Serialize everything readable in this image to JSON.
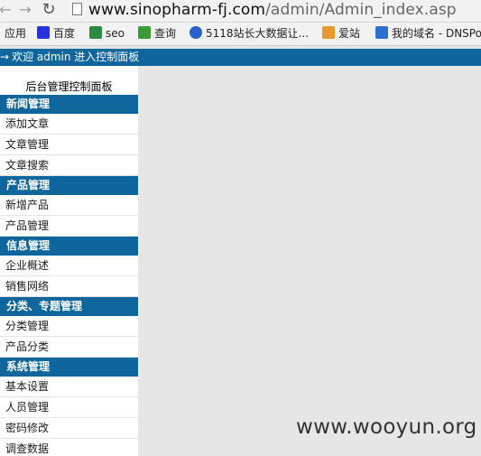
{
  "browser": {
    "url_host": "www.sinopharm-fj.com",
    "url_path": "/admin/Admin_index.asp",
    "bookmarks": [
      {
        "label": "应用",
        "icon": "apps-icon",
        "color": "#2a7de1"
      },
      {
        "label": "百度",
        "icon": "baidu-icon",
        "color": "#2932e1"
      },
      {
        "label": "seo",
        "icon": "seo-icon",
        "color": "#2b8c3f"
      },
      {
        "label": "查询",
        "icon": "query-icon",
        "color": "#3a9a3a"
      },
      {
        "label": "5118站长大数据让...",
        "icon": "5118-icon",
        "color": "#2a62c9"
      },
      {
        "label": "爱站",
        "icon": "aizhan-icon",
        "color": "#e89a2c"
      },
      {
        "label": "我的域名 - DNSPo",
        "icon": "dnspod-icon",
        "color": "#2d6fcf"
      }
    ]
  },
  "header": {
    "arrow": "→",
    "welcome": "欢迎 admin 进入控制面板"
  },
  "panel": {
    "title": "后台管理控制面板",
    "sections": [
      {
        "title": "新闻管理",
        "items": [
          "添加文章",
          "文章管理",
          "文章搜索"
        ]
      },
      {
        "title": "产品管理",
        "items": [
          "新增产品",
          "产品管理"
        ]
      },
      {
        "title": "信息管理",
        "items": [
          "企业概述",
          "销售网络"
        ]
      },
      {
        "title": "分类、专题管理",
        "items": [
          "分类管理",
          "产品分类"
        ]
      },
      {
        "title": "系统管理",
        "items": [
          "基本设置",
          "人员管理",
          "密码修改",
          "调查数据"
        ]
      }
    ]
  },
  "watermark": "www.wooyun.org",
  "colors": {
    "accent": "#0f669c",
    "content_bg": "#e6e6e6"
  }
}
